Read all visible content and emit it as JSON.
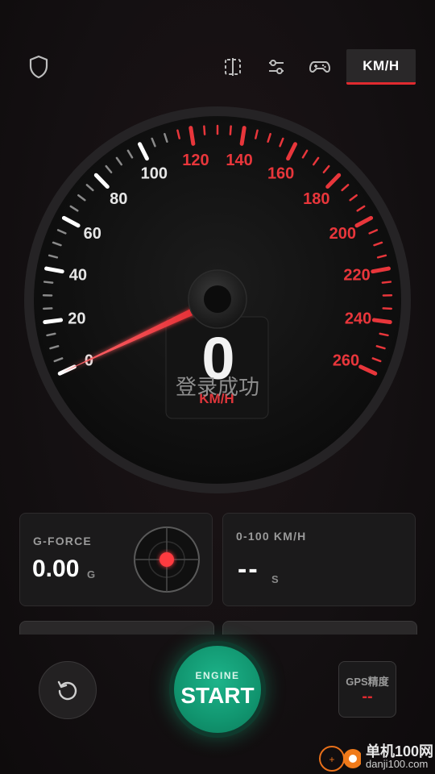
{
  "topbar": {
    "shield_icon": "shield-icon",
    "split_icon": "split-screen-icon",
    "sliders_icon": "sliders-icon",
    "gamepad_icon": "gamepad-icon",
    "unit_label": "KM/H"
  },
  "speedometer": {
    "current_speed": "0",
    "unit": "KM/H",
    "toast": "登录成功",
    "min": 0,
    "max": 260,
    "labels": [
      "0",
      "20",
      "40",
      "60",
      "80",
      "100",
      "120",
      "140",
      "160",
      "180",
      "200",
      "220",
      "240",
      "260"
    ],
    "needle_value": 0,
    "white_zone_max": 110,
    "red_color": "#e8363b"
  },
  "gforce": {
    "label": "G-FORCE",
    "value": "0.00",
    "unit": "G"
  },
  "accel": {
    "label": "0-100 KM/H",
    "value": "--",
    "unit": "S"
  },
  "controls": {
    "reset_icon": "reset-icon",
    "engine_label": "ENGINE",
    "start_label": "START",
    "gps_label": "GPS精度",
    "gps_value": "--"
  },
  "watermark": {
    "line1": "单机100网",
    "line2": "danji100.com"
  }
}
